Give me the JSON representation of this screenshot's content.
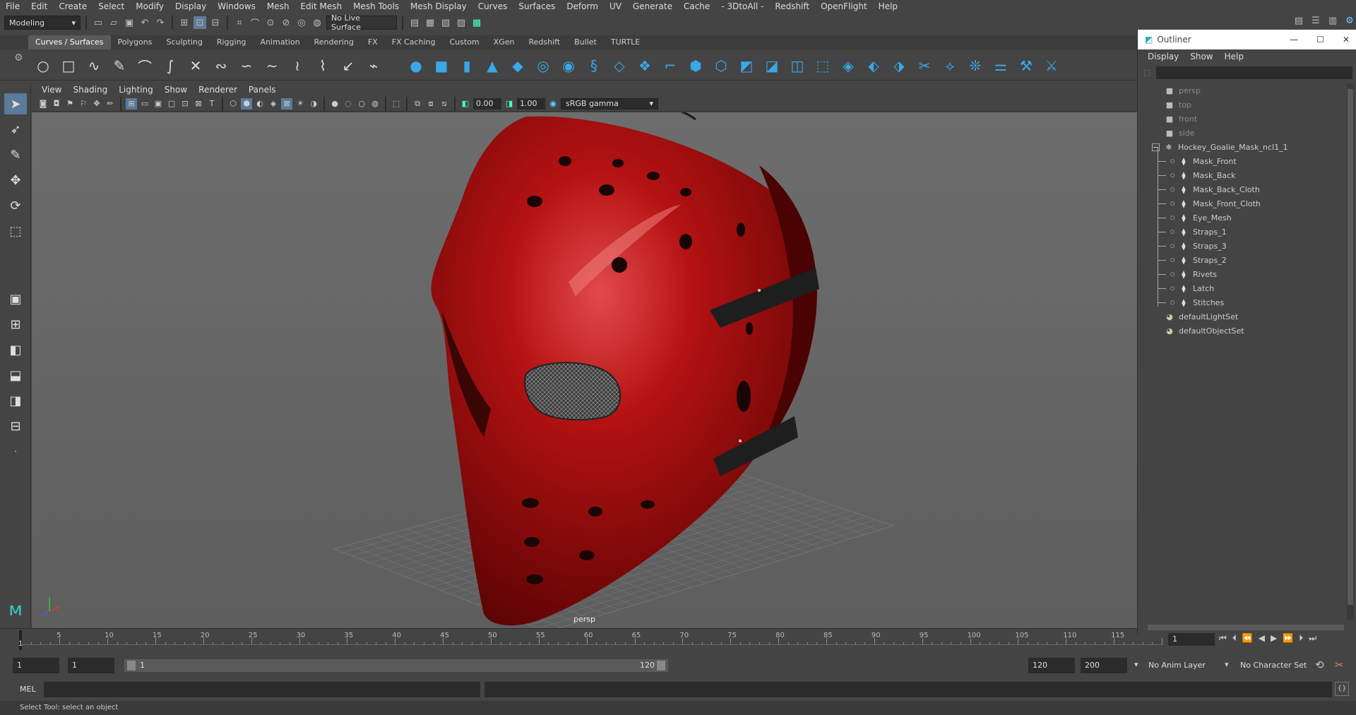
{
  "menubar": {
    "items": [
      "File",
      "Edit",
      "Create",
      "Select",
      "Modify",
      "Display",
      "Windows",
      "Mesh",
      "Edit Mesh",
      "Mesh Tools",
      "Mesh Display",
      "Curves",
      "Surfaces",
      "Deform",
      "UV",
      "Generate",
      "Cache",
      "- 3DtoAll -",
      "Redshift",
      "OpenFlight",
      "Help"
    ]
  },
  "status": {
    "mode": "Modeling",
    "live_surface": "No Live Surface"
  },
  "shelf": {
    "tabs": [
      "Curves / Surfaces",
      "Polygons",
      "Sculpting",
      "Rigging",
      "Animation",
      "Rendering",
      "FX",
      "FX Caching",
      "Custom",
      "XGen",
      "Redshift",
      "Bullet",
      "TURTLE"
    ],
    "active": "Curves / Surfaces"
  },
  "viewport": {
    "menu": [
      "View",
      "Shading",
      "Lighting",
      "Show",
      "Renderer",
      "Panels"
    ],
    "exposure": "0.00",
    "gamma": "1.00",
    "colorspace": "sRGB gamma",
    "camera_label": "persp",
    "accent": "#8b0a0a"
  },
  "outliner": {
    "title": "Outliner",
    "menu": [
      "Display",
      "Show",
      "Help"
    ],
    "items": [
      {
        "label": "persp",
        "icon": "camera-icon",
        "type": "camera"
      },
      {
        "label": "top",
        "icon": "camera-icon",
        "type": "camera"
      },
      {
        "label": "front",
        "icon": "camera-icon",
        "type": "camera"
      },
      {
        "label": "side",
        "icon": "camera-icon",
        "type": "camera"
      },
      {
        "label": "Hockey_Goalie_Mask_ncl1_1",
        "icon": "group-icon",
        "type": "group"
      },
      {
        "label": "Mask_Front",
        "icon": "mesh-icon",
        "type": "child"
      },
      {
        "label": "Mask_Back",
        "icon": "mesh-icon",
        "type": "child"
      },
      {
        "label": "Mask_Back_Cloth",
        "icon": "mesh-icon",
        "type": "child"
      },
      {
        "label": "Mask_Front_Cloth",
        "icon": "mesh-icon",
        "type": "child"
      },
      {
        "label": "Eye_Mesh",
        "icon": "mesh-icon",
        "type": "child"
      },
      {
        "label": "Straps_1",
        "icon": "mesh-icon",
        "type": "child"
      },
      {
        "label": "Straps_3",
        "icon": "mesh-icon",
        "type": "child"
      },
      {
        "label": "Straps_2",
        "icon": "mesh-icon",
        "type": "child"
      },
      {
        "label": "Rivets",
        "icon": "mesh-icon",
        "type": "child"
      },
      {
        "label": "Latch",
        "icon": "mesh-icon",
        "type": "child"
      },
      {
        "label": "Stitches",
        "icon": "mesh-icon",
        "type": "child"
      },
      {
        "label": "defaultLightSet",
        "icon": "set-icon",
        "type": "set"
      },
      {
        "label": "defaultObjectSet",
        "icon": "set-icon",
        "type": "set"
      }
    ]
  },
  "timeline": {
    "ticks": [
      "5",
      "10",
      "15",
      "20",
      "25",
      "30",
      "35",
      "40",
      "45",
      "50",
      "55",
      "60",
      "65",
      "70",
      "75",
      "80",
      "85",
      "90",
      "95",
      "100",
      "105",
      "110",
      "115"
    ],
    "start_label": "1",
    "current_frame": "1"
  },
  "range": {
    "start": "1",
    "playback_start": "1",
    "range_start": "1",
    "range_end": "120",
    "end": "120",
    "max": "200",
    "anim_layer": "No Anim Layer",
    "char_set": "No Character Set"
  },
  "cmd": {
    "label": "MEL"
  },
  "help": {
    "text": "Select Tool: select an object"
  }
}
